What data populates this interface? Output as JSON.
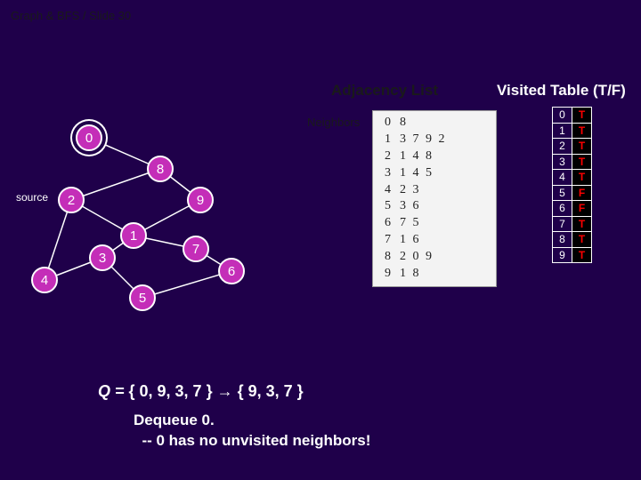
{
  "breadcrumb": "Graph & BFS / Slide 30",
  "headers": {
    "adjacency": "Adjacency List",
    "visited": "Visited Table (T/F)",
    "neighbors": "Neighbors"
  },
  "adjacency": [
    {
      "idx": "0",
      "vals": "8"
    },
    {
      "idx": "1",
      "vals": "3 7 9 2"
    },
    {
      "idx": "2",
      "vals": "1 4 8"
    },
    {
      "idx": "3",
      "vals": "1 4 5"
    },
    {
      "idx": "4",
      "vals": "2 3"
    },
    {
      "idx": "5",
      "vals": "3 6"
    },
    {
      "idx": "6",
      "vals": "7 5"
    },
    {
      "idx": "7",
      "vals": "1 6"
    },
    {
      "idx": "8",
      "vals": "2 0 9"
    },
    {
      "idx": "9",
      "vals": "1 8"
    }
  ],
  "visited": [
    {
      "i": "0",
      "v": "T"
    },
    {
      "i": "1",
      "v": "T"
    },
    {
      "i": "2",
      "v": "T"
    },
    {
      "i": "3",
      "v": "T"
    },
    {
      "i": "4",
      "v": "T"
    },
    {
      "i": "5",
      "v": "F"
    },
    {
      "i": "6",
      "v": "F"
    },
    {
      "i": "7",
      "v": "T"
    },
    {
      "i": "8",
      "v": "T"
    },
    {
      "i": "9",
      "v": "T"
    }
  ],
  "graph": {
    "source_label": "source",
    "nodes": {
      "n0": "0",
      "n1": "1",
      "n2": "2",
      "n3": "3",
      "n4": "4",
      "n5": "5",
      "n6": "6",
      "n7": "7",
      "n8": "8",
      "n9": "9"
    }
  },
  "queue": {
    "prefix": "Q = ",
    "text": "{ 0, 9, 3, 7 } → { 9, 3, 7 }"
  },
  "message": {
    "line1": "Dequeue 0.",
    "line2": "  -- 0 has no unvisited neighbors!"
  }
}
